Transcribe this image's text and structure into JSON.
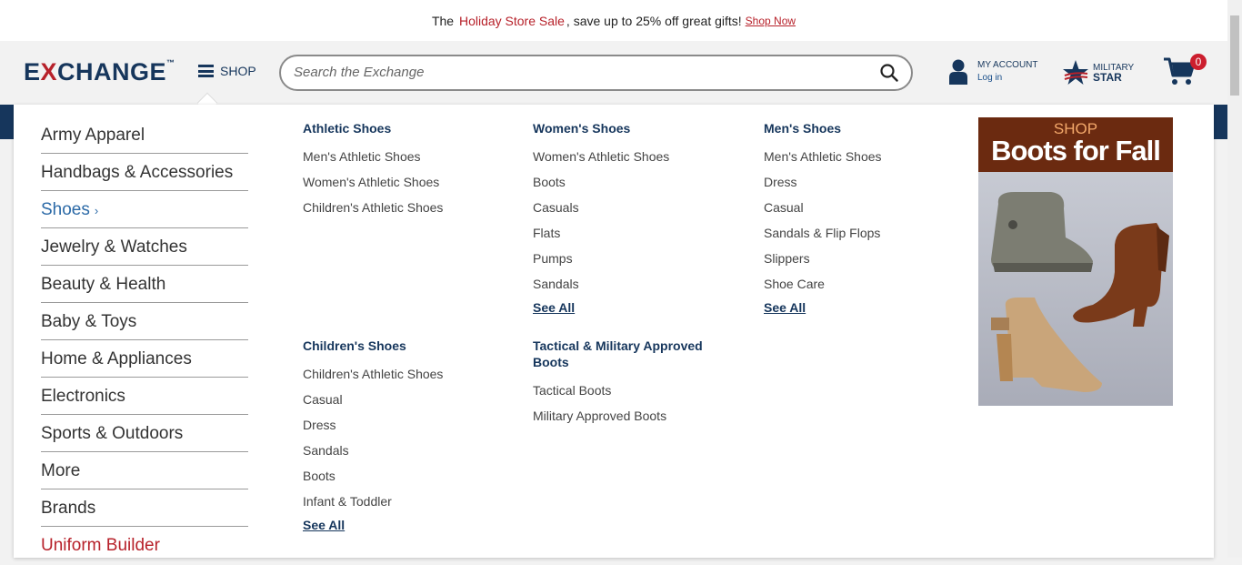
{
  "promo": {
    "prefix": "The",
    "highlight": "Holiday Store Sale",
    "suffix": ", save up to 25% off great gifts!",
    "link": "Shop Now"
  },
  "header": {
    "logo_left": "E",
    "logo_x": "X",
    "logo_right": "CHANGE",
    "logo_tm": "™",
    "shop_label": "SHOP",
    "search_placeholder": "Search the Exchange",
    "account_title": "MY ACCOUNT",
    "account_login": "Log in",
    "military_top": "MILITARY",
    "military_bottom": "STAR",
    "cart_count": "0"
  },
  "categories": [
    "Army Apparel",
    "Handbags & Accessories",
    "Shoes",
    "Jewelry & Watches",
    "Beauty & Health",
    "Baby & Toys",
    "Home & Appliances",
    "Electronics",
    "Sports & Outdoors",
    "More",
    "Brands",
    "Uniform Builder"
  ],
  "columns": {
    "athletic": {
      "title": "Athletic Shoes",
      "items": [
        "Men's Athletic Shoes",
        "Women's Athletic Shoes",
        "Children's Athletic Shoes"
      ]
    },
    "womens": {
      "title": "Women's Shoes",
      "items": [
        "Women's Athletic Shoes",
        "Boots",
        "Casuals",
        "Flats",
        "Pumps",
        "Sandals"
      ],
      "see_all": "See All"
    },
    "mens": {
      "title": "Men's Shoes",
      "items": [
        "Men's Athletic Shoes",
        "Dress",
        "Casual",
        "Sandals & Flip Flops",
        "Slippers",
        "Shoe Care"
      ],
      "see_all": "See All"
    },
    "childrens": {
      "title": "Children's Shoes",
      "items": [
        "Children's Athletic Shoes",
        "Casual",
        "Dress",
        "Sandals",
        "Boots",
        "Infant & Toddler"
      ],
      "see_all": "See All"
    },
    "tactical": {
      "title": "Tactical & Military Approved Boots",
      "items": [
        "Tactical Boots",
        "Military Approved Boots"
      ]
    }
  },
  "promo_banner": {
    "line1": "SHOP",
    "line2": "Boots for Fall"
  },
  "colors": {
    "navy": "#16365c",
    "red": "#b7212a",
    "link_blue": "#2c6aa7"
  }
}
